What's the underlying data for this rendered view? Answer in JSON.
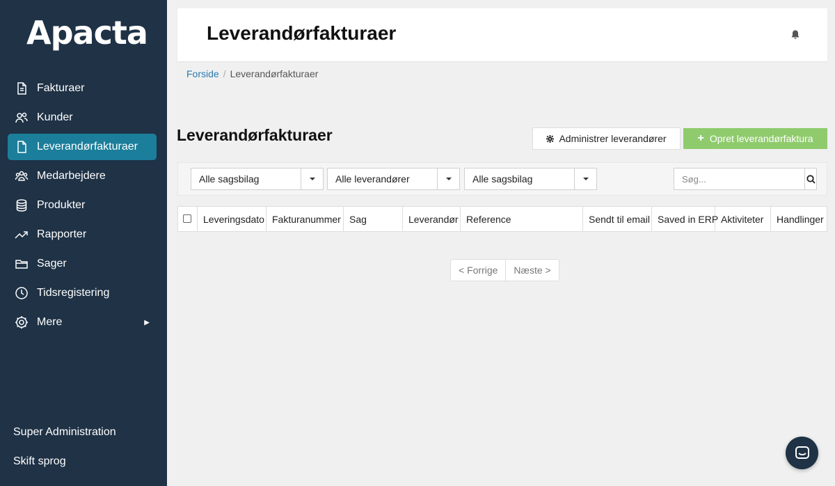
{
  "app": {
    "logo_text": "Apacta"
  },
  "sidebar": {
    "items": [
      {
        "label": "Fakturaer",
        "icon": "document-icon"
      },
      {
        "label": "Kunder",
        "icon": "users-icon"
      },
      {
        "label": "Leverandørfakturaer",
        "icon": "file-icon",
        "active": true
      },
      {
        "label": "Medarbejdere",
        "icon": "group-icon"
      },
      {
        "label": "Produkter",
        "icon": "database-icon"
      },
      {
        "label": "Rapporter",
        "icon": "trending-up-icon"
      },
      {
        "label": "Sager",
        "icon": "folder-icon"
      },
      {
        "label": "Tidsregistering",
        "icon": "clock-icon"
      },
      {
        "label": "Mere",
        "icon": "gear-icon",
        "has_submenu": true
      }
    ],
    "super_admin": "Super Administration",
    "change_language": "Skift sprog"
  },
  "header": {
    "title": "Leverandørfakturaer",
    "bell_icon": "bell-icon"
  },
  "breadcrumb": {
    "home": "Forside",
    "separator": "/",
    "current": "Leverandørfakturaer"
  },
  "main": {
    "title": "Leverandørfakturaer",
    "admin_button": "Administrer leverandører",
    "create_button": "Opret leverandørfaktura",
    "create_plus": "+"
  },
  "filters": {
    "select1": "Alle sagsbilag",
    "select2": "Alle leverandører",
    "select3": "Alle sagsbilag",
    "search_placeholder": "Søg..."
  },
  "table": {
    "columns": [
      "Leveringsdato",
      "Fakturanummer",
      "Sag",
      "Leverandør",
      "Reference",
      "Sendt til email",
      "Saved in ERP",
      "Aktiviteter",
      "Handlinger"
    ]
  },
  "pagination": {
    "prev": "< Forrige",
    "next": "Næste >"
  },
  "colors": {
    "sidebar_bg": "#1f3246",
    "active_item": "#1b7e9b",
    "create_button": "#8fcb6d",
    "link": "#2a7ab0"
  }
}
